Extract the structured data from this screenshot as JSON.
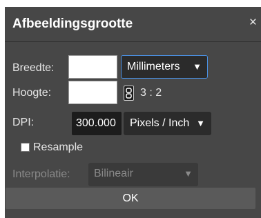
{
  "dialog": {
    "title": "Afbeeldingsgrootte",
    "close_glyph": "×"
  },
  "fields": {
    "width_label": "Breedte:",
    "width_value": "",
    "unit_select": "Millimeters",
    "height_label": "Hoogte:",
    "height_value": "",
    "link_icon": "link-icon",
    "aspect_ratio": "3 : 2",
    "dpi_label": "DPI:",
    "dpi_value": "300.000",
    "dpi_unit_select": "Pixels / Inch",
    "resample_label": "Resample",
    "interpolation_label": "Interpolatie:",
    "interpolation_select": "Bilineair",
    "chevron": "⌄"
  },
  "buttons": {
    "ok_label": "OK"
  }
}
